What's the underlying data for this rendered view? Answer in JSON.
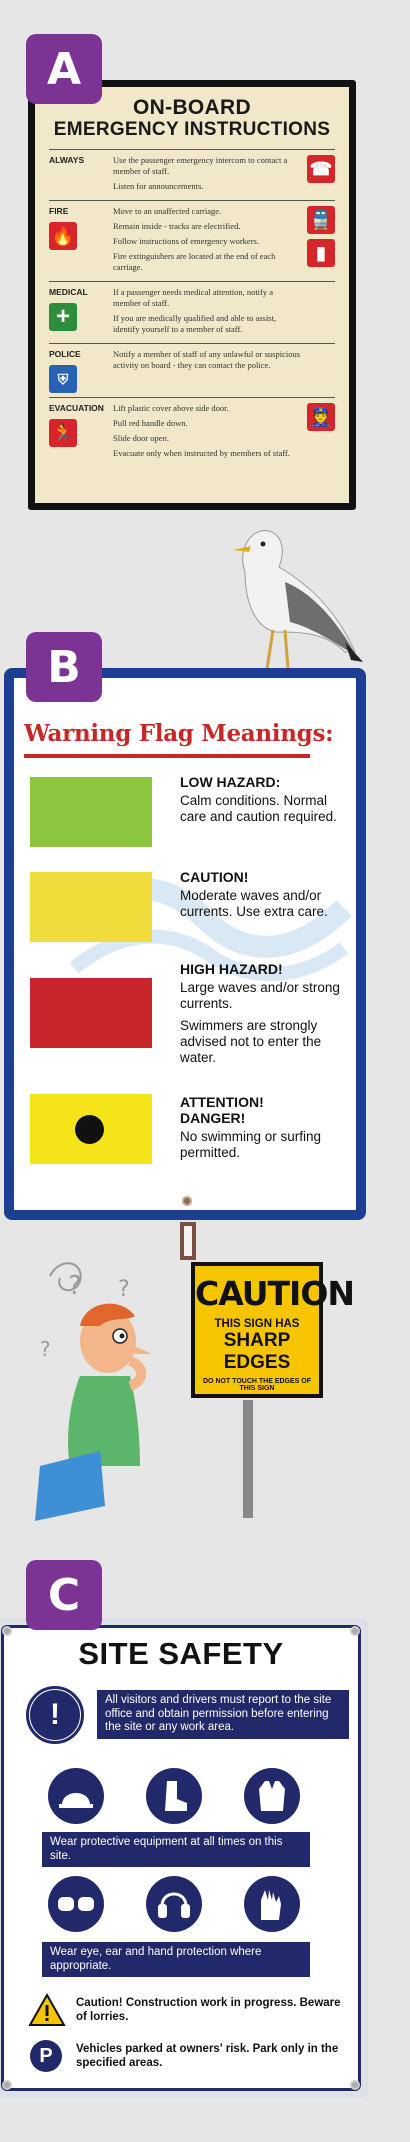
{
  "signA": {
    "badge": "A",
    "title_line1": "ON-BOARD",
    "title_line2": "EMERGENCY INSTRUCTIONS",
    "rows": [
      {
        "label": "ALWAYS",
        "lines": [
          "Use the passenger emergency intercom to contact a member of staff.",
          "Listen for announcements."
        ]
      },
      {
        "label": "FIRE",
        "lines": [
          "Move to an unaffected carriage.",
          "Remain inside - tracks are electrified.",
          "Follow instructions of emergency workers.",
          "Fire extinguishers are located at the end of each carriage."
        ]
      },
      {
        "label": "MEDICAL",
        "lines": [
          "If a passenger needs medical attention, notify a member of staff.",
          "If you are medically qualified and able to assist, identify yourself to a member of staff."
        ]
      },
      {
        "label": "POLICE",
        "lines": [
          "Notify a member of staff of any unlawful or suspicious activity on board - they can contact the police."
        ]
      },
      {
        "label": "EVACUATION",
        "lines": [
          "Lift plastic cover above side door.",
          "Pull red handle down.",
          "Slide door open.",
          "Evacuate only when instructed by members of staff."
        ]
      }
    ]
  },
  "signB": {
    "badge": "B",
    "title": "Warning Flag Meanings:",
    "flags": [
      {
        "heading": "LOW HAZARD:",
        "desc": "Calm conditions. Normal care and caution required.",
        "color": "#8cc63f"
      },
      {
        "heading": "CAUTION!",
        "desc": "Moderate waves and/or currents. Use extra care.",
        "color": "#f0dc3a"
      },
      {
        "heading": "HIGH HAZARD!",
        "desc": "Large waves and/or strong currents.",
        "desc2": "Swimmers are strongly advised not to enter the water.",
        "color": "#c8252b"
      },
      {
        "heading": "ATTENTION! DANGER!",
        "desc": "No swimming or surfing permitted.",
        "color": "#f6e41a"
      }
    ]
  },
  "caution_sign": {
    "line1": "CAUTION",
    "line2": "THIS SIGN HAS",
    "line3": "SHARP EDGES",
    "line4": "DO NOT TOUCH THE EDGES OF THIS SIGN"
  },
  "signC": {
    "badge": "C",
    "title": "SITE SAFETY",
    "notice": "All visitors and drivers must report to the site office and obtain permission before entering the site or any work area.",
    "ppe_text": "Wear protective equipment at all times on this site.",
    "protection_text": "Wear eye, ear and hand protection where appropriate.",
    "caution_text": "Caution! Construction work in progress. Beware of lorries.",
    "parking_text": "Vehicles parked at owners' risk. Park only in the specified areas."
  },
  "colors": {
    "purple": "#7b3394",
    "navy": "#22296a",
    "signB_border": "#1c3f92",
    "red": "#c62828"
  }
}
